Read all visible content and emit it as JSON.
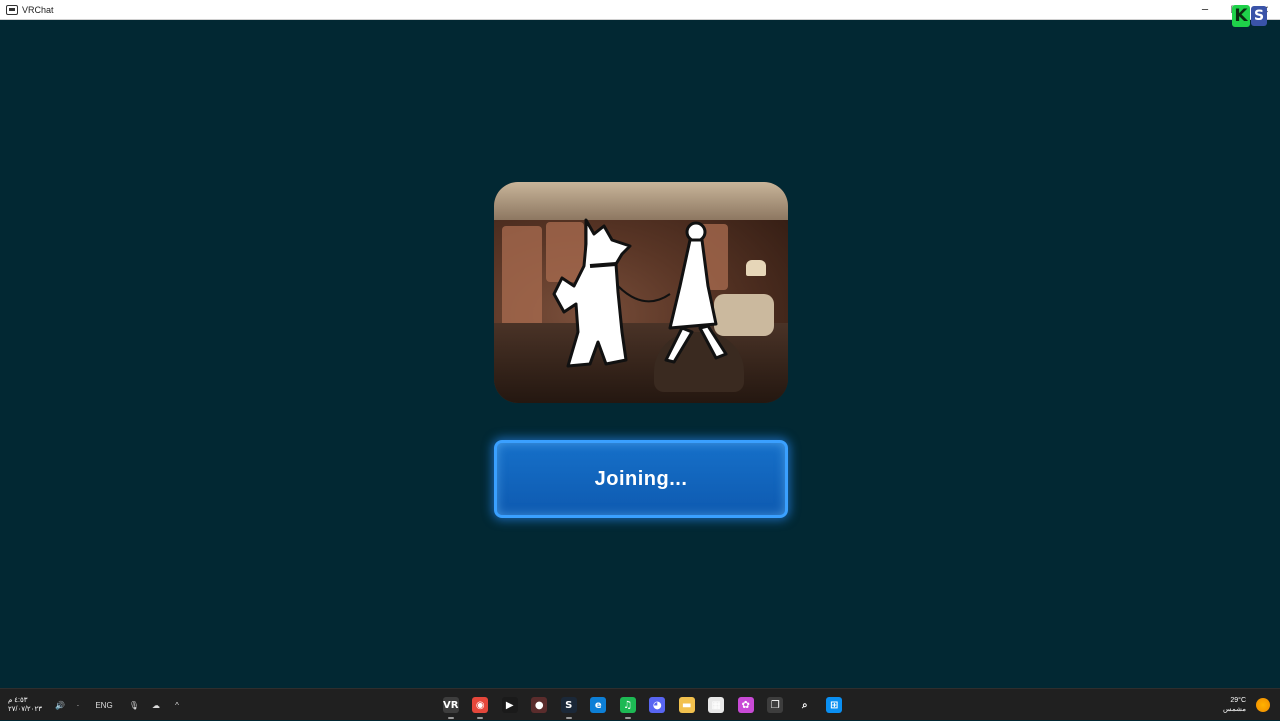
{
  "window": {
    "title": "VRChat",
    "minimize": "─",
    "maximize": "☐",
    "close": "✕"
  },
  "overlay_logo": {
    "k": "K",
    "s": "S",
    "colors": {
      "k": "#1fd14a",
      "s": "#3a53a8"
    }
  },
  "world": {
    "status_label": "Joining..."
  },
  "taskbar": {
    "clock": {
      "time": "٤:٥٣ م",
      "date": "٢٧/٠٧/٢٠٢٣"
    },
    "tray": {
      "volume": "🔊",
      "dot": "·",
      "language": "ENG",
      "mic": "🎙",
      "cloud": "☁",
      "chevron": "^"
    },
    "apps": [
      {
        "name": "vrchat",
        "glyph": "VR",
        "color": "#3d3d3d",
        "running": true
      },
      {
        "name": "chrome",
        "glyph": "◉",
        "color": "#e5473b",
        "running": true
      },
      {
        "name": "play",
        "glyph": "▶",
        "color": "#1a1a1a",
        "running": false
      },
      {
        "name": "obs",
        "glyph": "●",
        "color": "#5a2c2c",
        "running": false
      },
      {
        "name": "steam",
        "glyph": "S",
        "color": "#1b2838",
        "running": true
      },
      {
        "name": "edge",
        "glyph": "e",
        "color": "#0d7fd6",
        "running": false
      },
      {
        "name": "spotify",
        "glyph": "♫",
        "color": "#1db954",
        "running": true
      },
      {
        "name": "discord",
        "glyph": "◕",
        "color": "#5865f2",
        "running": false
      },
      {
        "name": "explorer",
        "glyph": "▬",
        "color": "#f2c14e",
        "running": false
      },
      {
        "name": "store",
        "glyph": "▦",
        "color": "#e8e8e8",
        "running": false
      },
      {
        "name": "copilot",
        "glyph": "✿",
        "color": "#c94ad6",
        "running": false
      },
      {
        "name": "task-view",
        "glyph": "❐",
        "color": "#3d3d3d",
        "running": false
      },
      {
        "name": "search",
        "glyph": "⌕",
        "color": "#202020",
        "running": false
      },
      {
        "name": "start",
        "glyph": "⊞",
        "color": "#0a8ff2",
        "running": false
      }
    ],
    "weather": {
      "temp": "29°C",
      "condition": "مشمس"
    }
  }
}
